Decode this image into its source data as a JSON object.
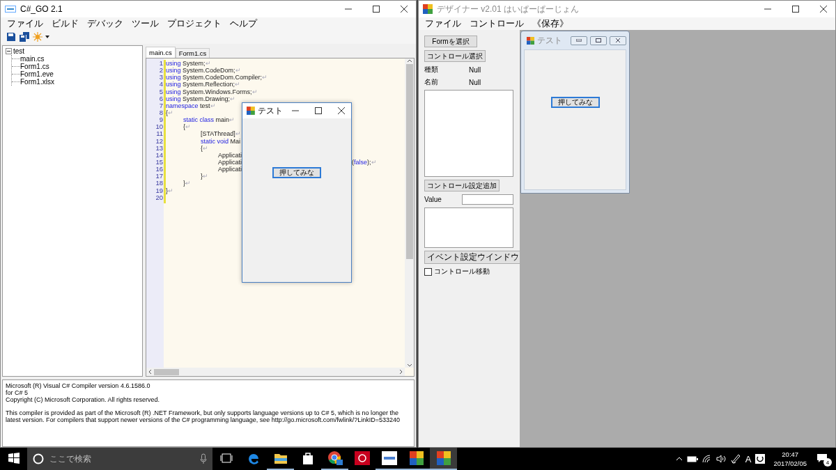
{
  "editor_window": {
    "title": "C#_GO  2.1",
    "active": true,
    "menu": [
      "ファイル",
      "ビルド",
      "デバック",
      "ツール",
      "プロジェクト",
      "ヘルプ"
    ],
    "tree": {
      "label": "test",
      "expanded": true,
      "children": [
        {
          "label": "main.cs"
        },
        {
          "label": "Form1.cs"
        },
        {
          "label": "Form1.eve"
        },
        {
          "label": "Form1.xlsx"
        }
      ]
    },
    "tabs": [
      {
        "label": "main.cs",
        "selected": true
      },
      {
        "label": "Form1.cs",
        "selected": false
      }
    ],
    "code": [
      {
        "number": "1",
        "tokens": [
          {
            "kind": "keyword",
            "text": "using"
          },
          {
            "kind": "plain",
            "text": " System;"
          },
          {
            "kind": "eol",
            "text": "↵"
          }
        ]
      },
      {
        "number": "2",
        "tokens": [
          {
            "kind": "keyword",
            "text": "using"
          },
          {
            "kind": "plain",
            "text": " System.CodeDom;"
          },
          {
            "kind": "eol",
            "text": "↵"
          }
        ]
      },
      {
        "number": "3",
        "tokens": [
          {
            "kind": "keyword",
            "text": "using"
          },
          {
            "kind": "plain",
            "text": " System.CodeDom.Compiler;"
          },
          {
            "kind": "eol",
            "text": "↵"
          }
        ]
      },
      {
        "number": "4",
        "tokens": [
          {
            "kind": "keyword",
            "text": "using"
          },
          {
            "kind": "plain",
            "text": " System.Reflection;"
          },
          {
            "kind": "eol",
            "text": "↵"
          }
        ]
      },
      {
        "number": "5",
        "tokens": [
          {
            "kind": "keyword",
            "text": "using"
          },
          {
            "kind": "plain",
            "text": " System.Windows.Forms;"
          },
          {
            "kind": "eol",
            "text": "↵"
          }
        ]
      },
      {
        "number": "6",
        "tokens": [
          {
            "kind": "keyword",
            "text": "using"
          },
          {
            "kind": "plain",
            "text": " System.Drawing;"
          },
          {
            "kind": "eol",
            "text": "↵"
          }
        ]
      },
      {
        "number": "7",
        "tokens": [
          {
            "kind": "keyword",
            "text": "namespace"
          },
          {
            "kind": "plain",
            "text": " test"
          },
          {
            "kind": "eol",
            "text": "↵"
          }
        ]
      },
      {
        "number": "8",
        "tokens": [
          {
            "kind": "plain",
            "text": "{"
          },
          {
            "kind": "eol",
            "text": "↵"
          }
        ]
      },
      {
        "number": "9",
        "tokens": [
          {
            "kind": "keyword",
            "text": "\tstatic class"
          },
          {
            "kind": "plain",
            "text": " main"
          },
          {
            "kind": "eol",
            "text": "↵"
          }
        ]
      },
      {
        "number": "10",
        "tokens": [
          {
            "kind": "plain",
            "text": "\t{"
          },
          {
            "kind": "eol",
            "text": "↵"
          }
        ]
      },
      {
        "number": "11",
        "tokens": [
          {
            "kind": "plain",
            "text": "\t\t[STAThread]"
          },
          {
            "kind": "eol",
            "text": "↵"
          }
        ]
      },
      {
        "number": "12",
        "tokens": [
          {
            "kind": "keyword",
            "text": "\t\tstatic void"
          },
          {
            "kind": "plain",
            "text": " Mai"
          }
        ]
      },
      {
        "number": "13",
        "tokens": [
          {
            "kind": "plain",
            "text": "\t\t{"
          },
          {
            "kind": "eol",
            "text": "↵"
          }
        ]
      },
      {
        "number": "14",
        "tokens": [
          {
            "kind": "plain",
            "text": "\t\t\tApplicati"
          }
        ]
      },
      {
        "number": "15",
        "tokens": [
          {
            "kind": "plain",
            "text": "\t\t\tApplicati"
          }
        ],
        "tail": [
          {
            "kind": "plain",
            "text": "("
          },
          {
            "kind": "keyword",
            "text": "false"
          },
          {
            "kind": "plain",
            "text": ");"
          },
          {
            "kind": "eol",
            "text": "↵"
          }
        ]
      },
      {
        "number": "16",
        "tokens": [
          {
            "kind": "plain",
            "text": "\t\t\tApplicati"
          }
        ]
      },
      {
        "number": "17",
        "tokens": [
          {
            "kind": "plain",
            "text": "\t\t}"
          },
          {
            "kind": "eol",
            "text": "↵"
          }
        ]
      },
      {
        "number": "18",
        "tokens": [
          {
            "kind": "plain",
            "text": "\t}"
          },
          {
            "kind": "eol",
            "text": "↵"
          }
        ]
      },
      {
        "number": "19",
        "tokens": [
          {
            "kind": "plain",
            "text": "}"
          },
          {
            "kind": "eol",
            "text": "↵"
          }
        ]
      },
      {
        "number": "20"
      }
    ],
    "output": [
      {
        "lines": [
          "Microsoft (R) Visual C# Compiler version 4.6.1586.0",
          "for C# 5",
          "Copyright (C) Microsoft Corporation. All rights reserved."
        ]
      },
      {
        "lines": [
          "This compiler is provided as part of the Microsoft (R) .NET Framework, but only supports language versions up to C# 5, which is no longer the",
          "latest version. For compilers that support newer versions of the C# programming language, see http://go.microsoft.com/fwlink/?LinkID=533240"
        ]
      }
    ],
    "floating_form": {
      "title": "テスト",
      "button": "押してみな"
    }
  },
  "designer_window": {
    "title": "デザイナー v2.01 はいぱーぱーじょん",
    "active": false,
    "menu": [
      "ファイル",
      "コントロール",
      "《保存》"
    ],
    "select_form_button": "Formを選択",
    "select_control_button": "コントロール選択",
    "properties": [
      {
        "label": "種類",
        "value": "Null"
      },
      {
        "label": "名前",
        "value": "Null"
      }
    ],
    "add_setting_button": "コントロール設定追加",
    "value_field": {
      "label": "Value"
    },
    "event_button": "イベント設定ウインドウ",
    "move_checkbox": {
      "label": "コントロール移動",
      "checked": false
    },
    "preview_form": {
      "title": "テスト",
      "button": "押してみな"
    }
  },
  "taskbar": {
    "search": {
      "placeholder": "ここで検索"
    },
    "apps": [
      {
        "kind": "edge",
        "running": false,
        "active": false
      },
      {
        "kind": "explorer",
        "running": true,
        "active": false
      },
      {
        "kind": "store",
        "running": false,
        "active": false
      },
      {
        "kind": "chrome",
        "running": true,
        "active": false
      },
      {
        "kind": "adobe",
        "running": false,
        "active": false
      },
      {
        "kind": "csgo",
        "running": true,
        "active": false
      },
      {
        "kind": "designer",
        "running": true,
        "active": false
      },
      {
        "kind": "designer",
        "running": true,
        "active": true
      }
    ],
    "ime": "A",
    "time": "20:47",
    "date": "2017/02/05",
    "notifications": "4"
  }
}
